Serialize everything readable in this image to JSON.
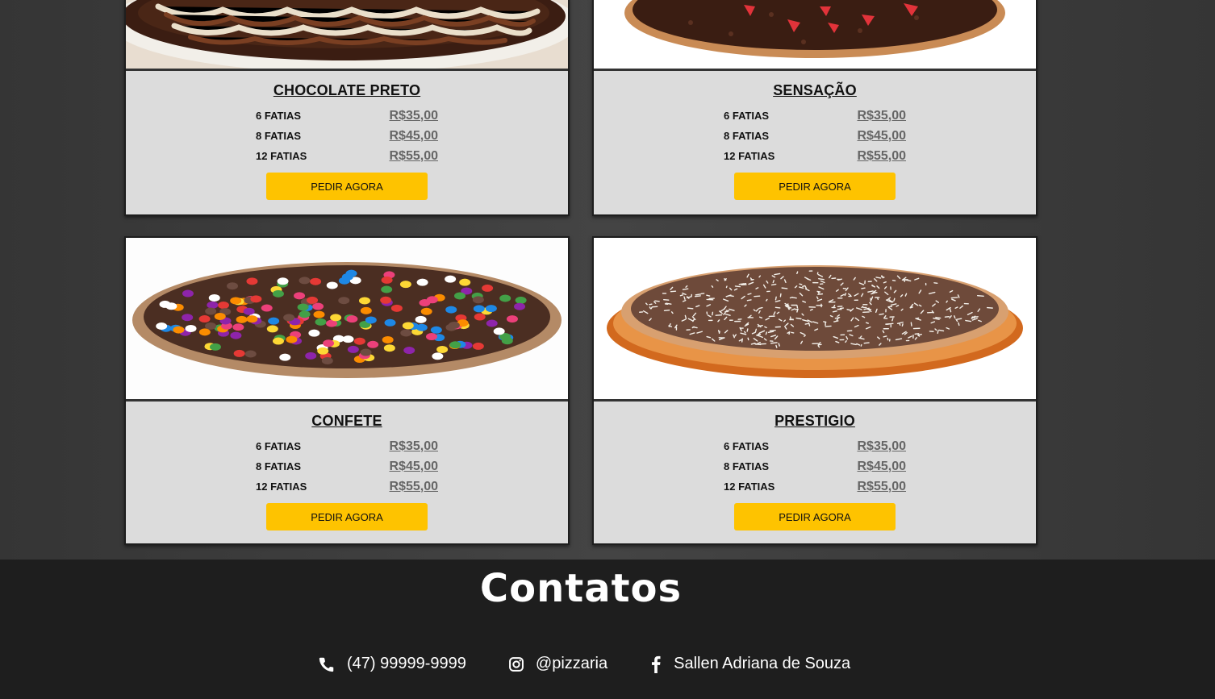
{
  "products": [
    {
      "name": "CHOCOLATE PRETO",
      "prices": [
        {
          "size": "6 FATIAS",
          "price": "R$35,00"
        },
        {
          "size": "8 FATIAS",
          "price": "R$45,00"
        },
        {
          "size": "12 FATIAS",
          "price": "R$55,00"
        }
      ],
      "button": "PEDIR AGORA"
    },
    {
      "name": "SENSAÇÃO",
      "prices": [
        {
          "size": "6 FATIAS",
          "price": "R$35,00"
        },
        {
          "size": "8 FATIAS",
          "price": "R$45,00"
        },
        {
          "size": "12 FATIAS",
          "price": "R$55,00"
        }
      ],
      "button": "PEDIR AGORA"
    },
    {
      "name": "CONFETE",
      "prices": [
        {
          "size": "6 FATIAS",
          "price": "R$35,00"
        },
        {
          "size": "8 FATIAS",
          "price": "R$45,00"
        },
        {
          "size": "12 FATIAS",
          "price": "R$55,00"
        }
      ],
      "button": "PEDIR AGORA"
    },
    {
      "name": "PRESTIGIO",
      "prices": [
        {
          "size": "6 FATIAS",
          "price": "R$35,00"
        },
        {
          "size": "8 FATIAS",
          "price": "R$45,00"
        },
        {
          "size": "12 FATIAS",
          "price": "R$55,00"
        }
      ],
      "button": "PEDIR AGORA"
    }
  ],
  "footer": {
    "title": "Contatos",
    "phone": "(47) 99999-9999",
    "instagram": "@pizzaria",
    "facebook": "Sallen Adriana de Souza"
  },
  "colors": {
    "accent": "#fec300",
    "card_bg": "#dcdcdc",
    "footer_bg": "#1e1e1e"
  }
}
